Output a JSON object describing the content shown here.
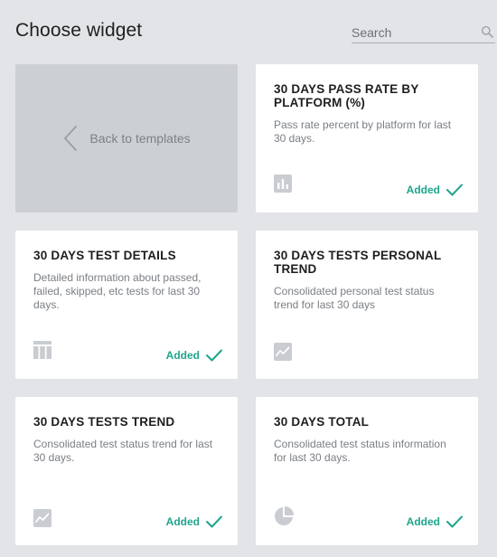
{
  "header": {
    "title": "Choose widget",
    "search_placeholder": "Search"
  },
  "back": {
    "label": "Back to templates"
  },
  "colors": {
    "accent": "#1fa58c",
    "background": "#e2e4e7",
    "card": "#ffffff",
    "back_card": "#cdd0d3",
    "icon": "#c9ccd0"
  },
  "widgets": [
    {
      "title": "30 DAYS PASS RATE BY PLATFORM (%)",
      "description": "Pass rate percent by platform for last 30 days.",
      "icon": "bar-chart-icon",
      "status": "Added"
    },
    {
      "title": "30 DAYS TEST DETAILS",
      "description": "Detailed information about passed, failed, skipped, etc tests for last 30 days.",
      "icon": "table-icon",
      "status": "Added"
    },
    {
      "title": "30 DAYS TESTS PERSONAL TREND",
      "description": "Consolidated personal test status trend for last 30 days",
      "icon": "line-chart-icon",
      "status": ""
    },
    {
      "title": "30 DAYS TESTS TREND",
      "description": "Consolidated test status trend for last 30 days.",
      "icon": "line-chart-icon",
      "status": "Added"
    },
    {
      "title": "30 DAYS TOTAL",
      "description": "Consolidated test status information for last 30 days.",
      "icon": "pie-chart-icon",
      "status": "Added"
    }
  ]
}
